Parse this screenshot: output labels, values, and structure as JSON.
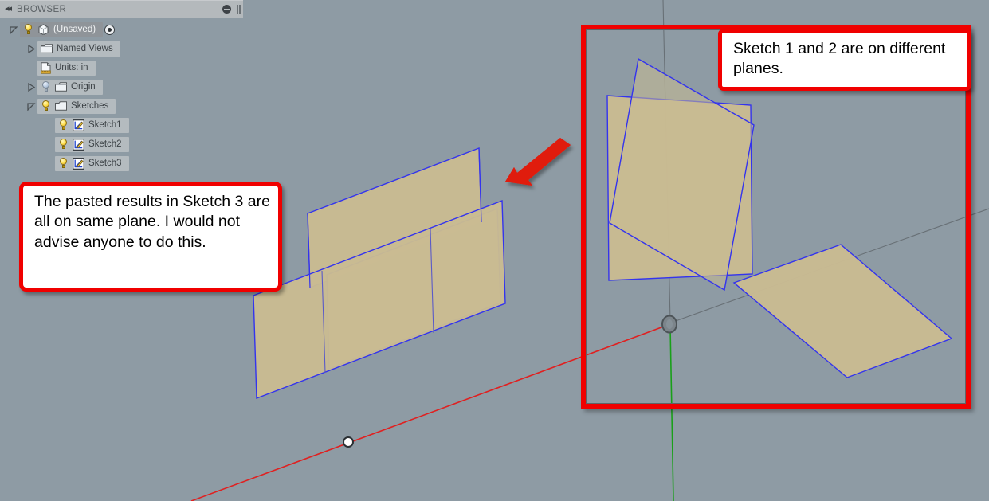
{
  "app": {
    "background_color": "#8e9ba4",
    "viewport_name": "3d-design-viewport"
  },
  "browser": {
    "header": {
      "title": "BROWSER",
      "collapse_icon": "double-chevron-left-icon",
      "minimize_icon": "minus-circle-icon",
      "grip_icon": "panel-grip-icon"
    },
    "tree": [
      {
        "label": "(Unsaved)",
        "icon": "document-cube-icon",
        "bulb": "on",
        "twisty": "expanded",
        "indent": 0,
        "selected": true,
        "trailing_icon": "target-dot-icon",
        "name": "tree-item-unsaved-document"
      },
      {
        "label": "Named Views",
        "icon": "folder-icon",
        "bulb": "none",
        "twisty": "collapsed",
        "indent": 1,
        "selected": false,
        "trailing_icon": "",
        "name": "tree-item-named-views"
      },
      {
        "label": "Units: in",
        "icon": "units-document-icon",
        "bulb": "none",
        "twisty": "none",
        "indent": 1,
        "selected": false,
        "trailing_icon": "",
        "name": "tree-item-units"
      },
      {
        "label": "Origin",
        "icon": "folder-icon",
        "bulb": "off",
        "twisty": "collapsed",
        "indent": 1,
        "selected": false,
        "trailing_icon": "",
        "name": "tree-item-origin"
      },
      {
        "label": "Sketches",
        "icon": "folder-icon",
        "bulb": "on",
        "twisty": "expanded",
        "indent": 1,
        "selected": false,
        "trailing_icon": "",
        "name": "tree-item-sketches"
      },
      {
        "label": "Sketch1",
        "icon": "sketch-icon",
        "bulb": "on",
        "twisty": "none",
        "indent": 2,
        "selected": false,
        "trailing_icon": "",
        "name": "tree-item-sketch1"
      },
      {
        "label": "Sketch2",
        "icon": "sketch-icon",
        "bulb": "on",
        "twisty": "none",
        "indent": 2,
        "selected": false,
        "trailing_icon": "",
        "name": "tree-item-sketch2"
      },
      {
        "label": "Sketch3",
        "icon": "sketch-icon",
        "bulb": "on",
        "twisty": "none",
        "indent": 2,
        "selected": false,
        "trailing_icon": "",
        "name": "tree-item-sketch3"
      }
    ]
  },
  "annotations": {
    "callout_left": {
      "text": "The pasted results in Sketch 3 are all on same plane. I would not advise anyone to do this.",
      "border_color": "#f00000",
      "fill_color": "#ffffff"
    },
    "callout_right": {
      "text": "Sketch 1 and 2 are on different planes.",
      "border_color": "#f00000",
      "fill_color": "#ffffff"
    },
    "arrow": {
      "name": "red-pointer-arrow",
      "color": "#e01b10",
      "direction": "down-left"
    },
    "highlight_box": {
      "name": "red-highlight-rectangle",
      "color": "#f00000"
    }
  },
  "geometry": {
    "sketch_fill": "#c9bb92",
    "sketch_edge": "#3333ee",
    "axis_x_color": "#e02020",
    "axis_y_color": "#19a019",
    "axis_guide_color": "#5f666b",
    "origin_marker": "origin-point-icon",
    "snap_point": "white-vertex-point-icon"
  }
}
